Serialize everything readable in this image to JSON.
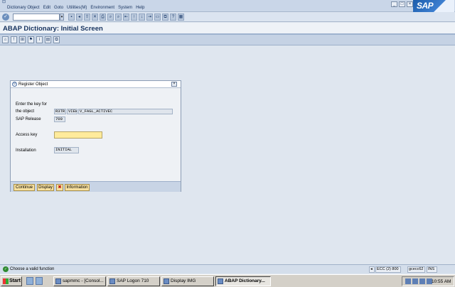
{
  "menubar": {
    "items": [
      "Dictionary Object",
      "Edit",
      "Goto",
      "Utilities(M)",
      "Environment",
      "System",
      "Help"
    ],
    "logo_text": "SAP"
  },
  "standard_toolbar": {
    "command_field": {
      "value": "",
      "placeholder": ""
    }
  },
  "title": "ABAP Dictionary: Initial Screen",
  "dialog": {
    "title": "Register Object",
    "intro_line1": "Enter the key for",
    "intro_line2": "the object",
    "key_fields": [
      "R3TR",
      "VIEW",
      "V_FAGL_ACTIVEC"
    ],
    "sap_release_label": "SAP Release",
    "sap_release_value": "700",
    "access_key_label": "Access key",
    "access_key_value": "",
    "installation_label": "Installation",
    "installation_value": "INITIAL",
    "buttons": {
      "continue": "Continue",
      "display": "Display",
      "cancel": "✖",
      "information": "Information"
    }
  },
  "statusbar": {
    "message": "Choose a valid function",
    "system": "ECC (2) 800",
    "server": "gcecc62",
    "mode": "INS"
  },
  "taskbar": {
    "start": "Start",
    "tasks": [
      "sapmmc - [Consol...",
      "SAP Logon 710",
      "Display IMG",
      "ABAP Dictionary..."
    ],
    "active_task": 3,
    "clock": "10:55 AM"
  },
  "colors": {
    "title_text": "#17335f",
    "input_highlight": "#ffeb9c",
    "button_fill": "#f6df9e",
    "cancel_red": "#c0150e"
  }
}
